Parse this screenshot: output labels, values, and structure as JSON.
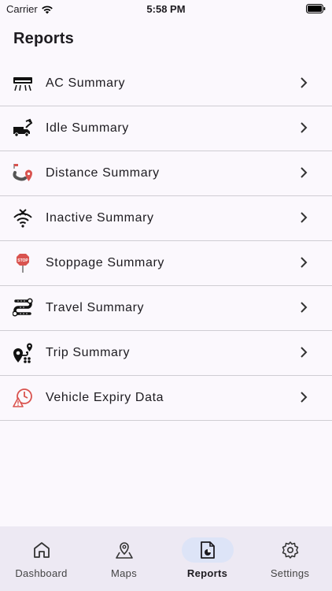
{
  "status_bar": {
    "carrier": "Carrier",
    "time": "5:58 PM"
  },
  "page": {
    "title": "Reports"
  },
  "reports": [
    {
      "label": "AC Summary",
      "icon": "ac-unit-icon"
    },
    {
      "label": "Idle Summary",
      "icon": "idle-truck-icon"
    },
    {
      "label": "Distance Summary",
      "icon": "distance-route-icon"
    },
    {
      "label": "Inactive Summary",
      "icon": "no-signal-icon"
    },
    {
      "label": "Stoppage Summary",
      "icon": "stop-sign-icon"
    },
    {
      "label": "Travel Summary",
      "icon": "travel-route-icon"
    },
    {
      "label": "Trip Summary",
      "icon": "trip-pins-icon"
    },
    {
      "label": "Vehicle Expiry Data",
      "icon": "expiry-alert-icon"
    }
  ],
  "nav": {
    "active": "Reports",
    "items": [
      {
        "label": "Dashboard",
        "icon": "home-icon"
      },
      {
        "label": "Maps",
        "icon": "map-pin-icon"
      },
      {
        "label": "Reports",
        "icon": "report-icon"
      },
      {
        "label": "Settings",
        "icon": "gear-icon"
      }
    ]
  },
  "colors": {
    "accent_red": "#d9534f",
    "active_pill": "#dde4f7",
    "nav_bg": "#ede9f3"
  }
}
